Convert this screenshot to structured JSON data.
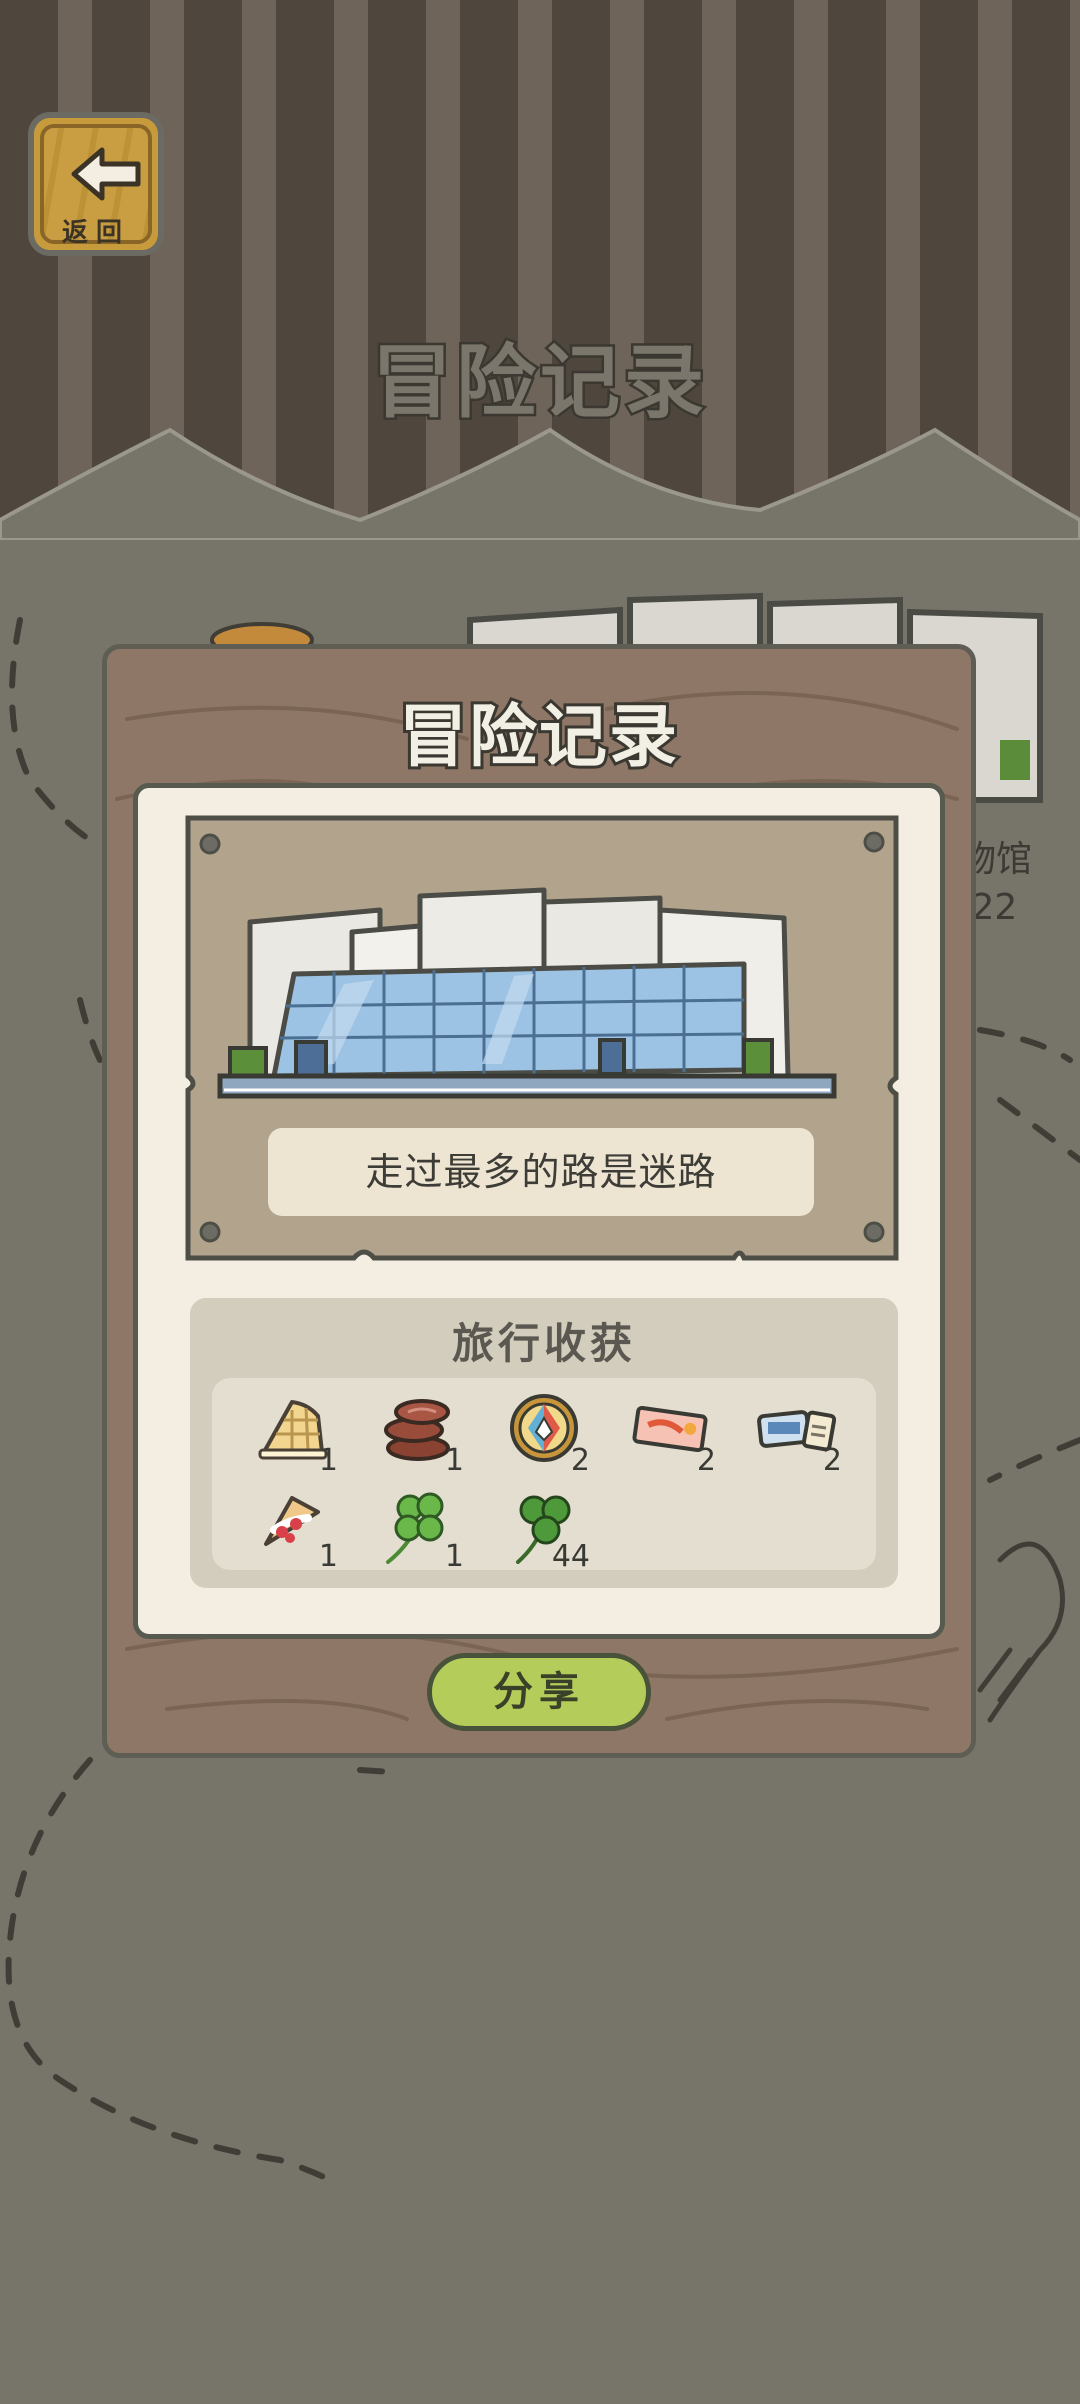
{
  "header": {
    "back_label": "返回",
    "title": "冒险记录"
  },
  "background": {
    "place_label": "物馆",
    "place_date": ".22"
  },
  "dialog": {
    "title": "冒险记录",
    "caption": "走过最多的路是迷路",
    "rewards_title": "旅行收获",
    "share_label": "分享",
    "rewards": [
      {
        "item": "waffle-icon",
        "count": "1"
      },
      {
        "item": "chocolate-roll-icon",
        "count": "1"
      },
      {
        "item": "compass-icon",
        "count": "2"
      },
      {
        "item": "ticket-icon",
        "count": "2"
      },
      {
        "item": "bus-ticket-icon",
        "count": "2"
      },
      {
        "item": "crepe-icon",
        "count": "1"
      },
      {
        "item": "four-leaf-clover-icon",
        "count": "1"
      },
      {
        "item": "clover-icon",
        "count": "44"
      }
    ]
  },
  "colors": {
    "background": "#77746a",
    "stripe_dark": "#4f463e",
    "stripe_light": "#6e645a",
    "wood": "#8e7766",
    "card": "#f3eee1",
    "share_button": "#b4cd5a"
  }
}
